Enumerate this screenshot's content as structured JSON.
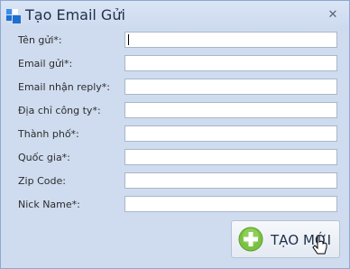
{
  "window": {
    "title": "Tạo Email Gửi",
    "close_glyph": "✕"
  },
  "form": {
    "fields": [
      {
        "label": "Tên gửi*:",
        "value": ""
      },
      {
        "label": "Email gửi*:",
        "value": ""
      },
      {
        "label": "Email nhận reply*:",
        "value": ""
      },
      {
        "label": "Địa chỉ công ty*:",
        "value": ""
      },
      {
        "label": "Thành phố*:",
        "value": ""
      },
      {
        "label": "Quốc gia*:",
        "value": ""
      },
      {
        "label": "Zip Code:",
        "value": ""
      },
      {
        "label": "Nick Name*:",
        "value": ""
      }
    ]
  },
  "actions": {
    "submit_label": "TẠO MỚI"
  },
  "icons": {
    "app": "app-logo-icon",
    "submit": "plus-circle-icon",
    "cursor": "mouse-pointer-icon"
  },
  "colors": {
    "window_bg": "#cfdcef",
    "accent_green": "#7bc142",
    "app_icon_blue": "#1f6fd1"
  }
}
